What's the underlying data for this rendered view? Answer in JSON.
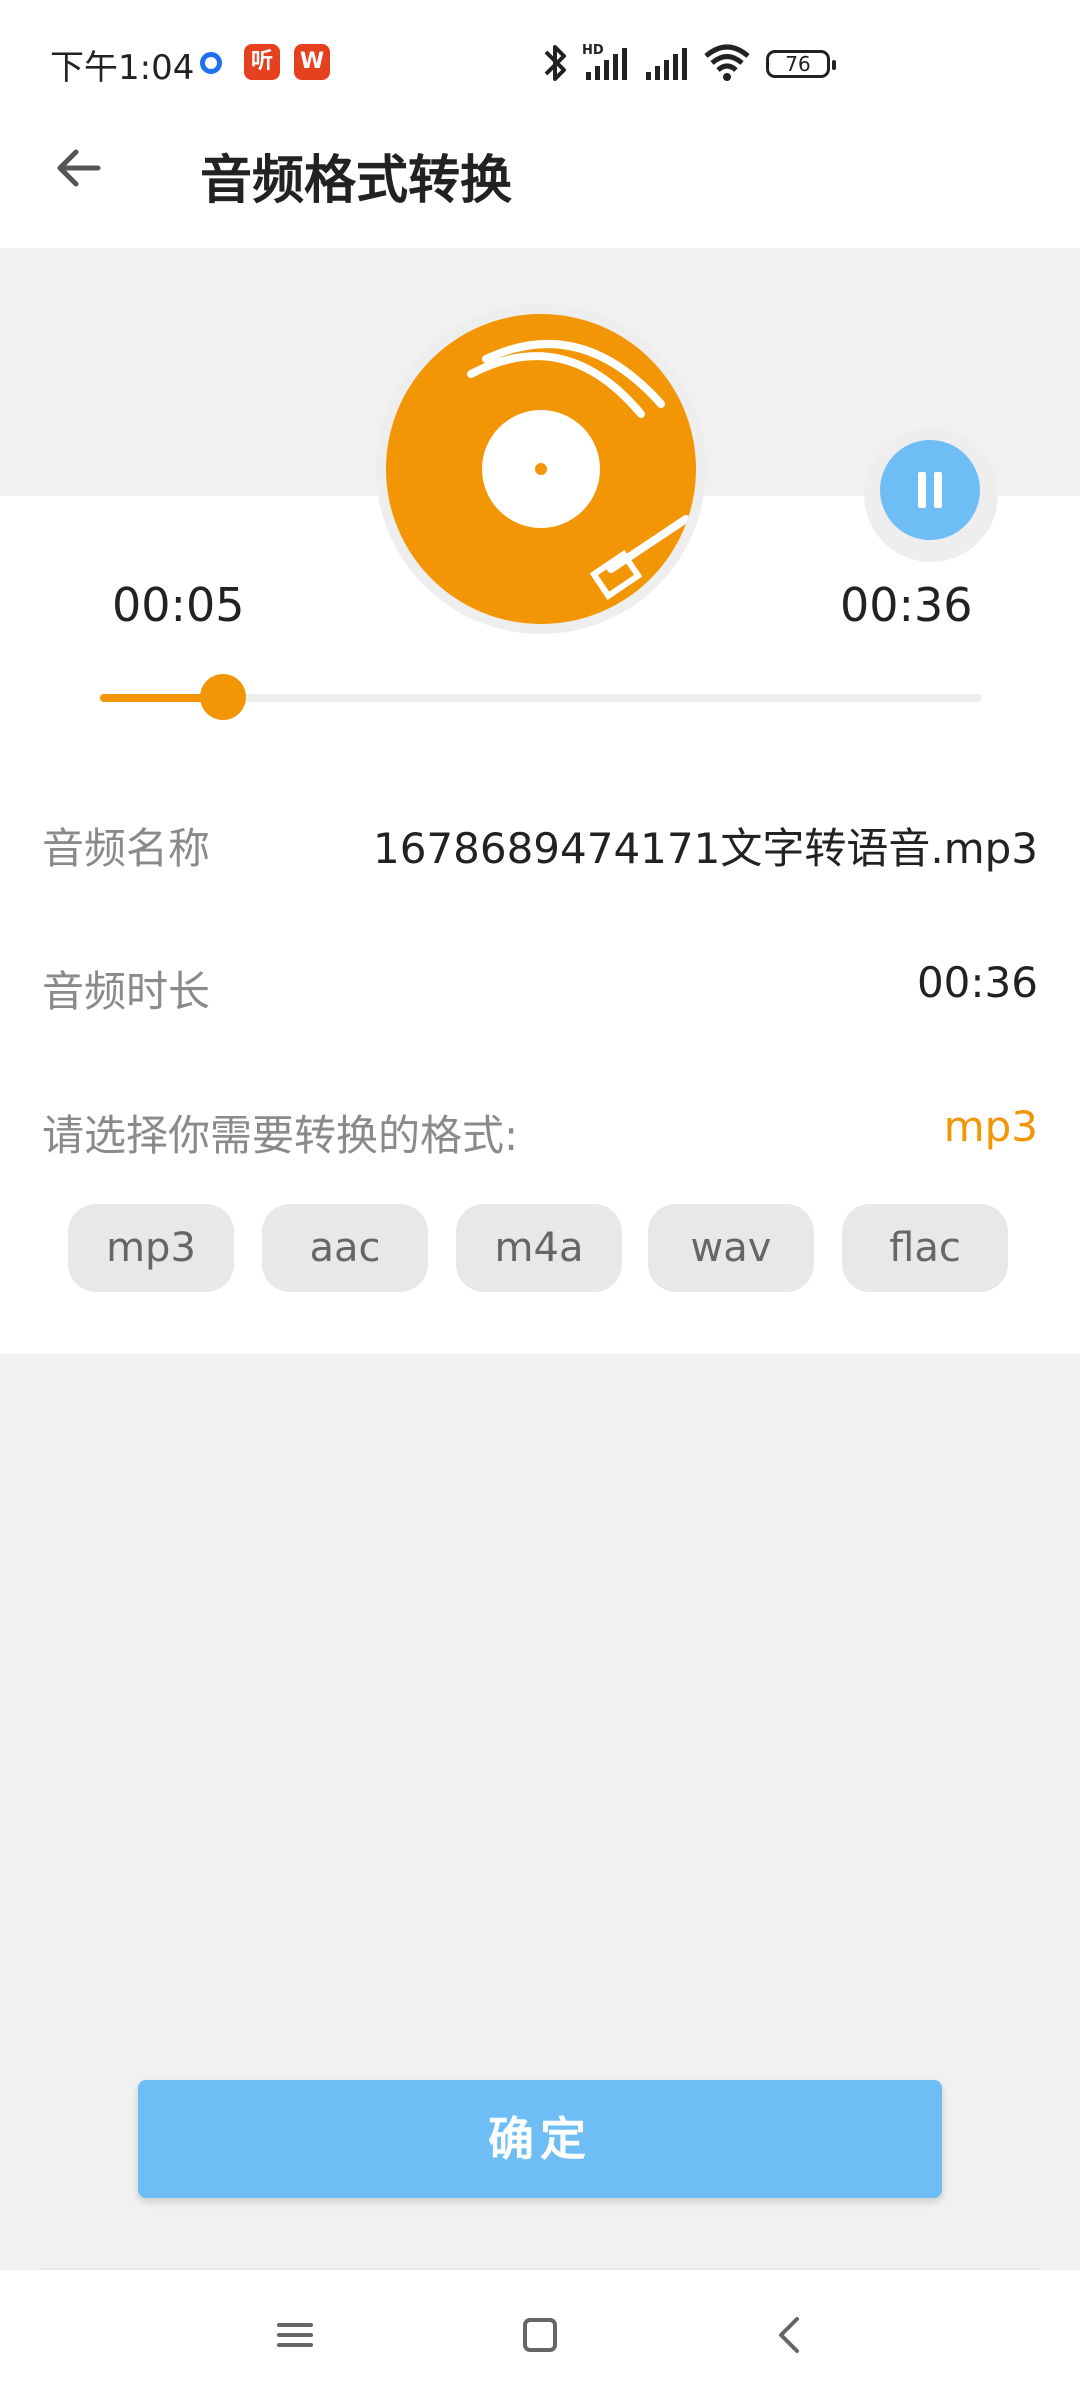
{
  "status_bar": {
    "time": "下午1:04",
    "badge_1": "听",
    "badge_2": "W",
    "battery": "76",
    "icons": [
      "notification-dot-icon",
      "bluetooth-icon",
      "hd-signal-icon",
      "signal-icon",
      "wifi-icon",
      "battery-icon"
    ]
  },
  "header": {
    "title": "音频格式转换",
    "back_icon": "arrow-left-icon"
  },
  "player": {
    "elapsed": "00:05",
    "total": "00:36",
    "progress": 0.139,
    "state_icon": "pause-icon",
    "record_icon": "vinyl-record-icon"
  },
  "info": {
    "name_label": "音频名称",
    "name_value": "1678689474171文字转语音.mp3",
    "duration_label": "音频时长",
    "duration_value": "00:36",
    "format_prompt": "请选择你需要转换的格式:",
    "selected_format": "mp3"
  },
  "formats": [
    "mp3",
    "aac",
    "m4a",
    "wav",
    "flac"
  ],
  "confirm_label": "确定",
  "nav": {
    "icons": [
      "menu-icon",
      "home-icon",
      "back-icon"
    ]
  },
  "colors": {
    "accent": "#f29605",
    "primary": "#6ebdf5",
    "background": "#f1f1f1"
  }
}
